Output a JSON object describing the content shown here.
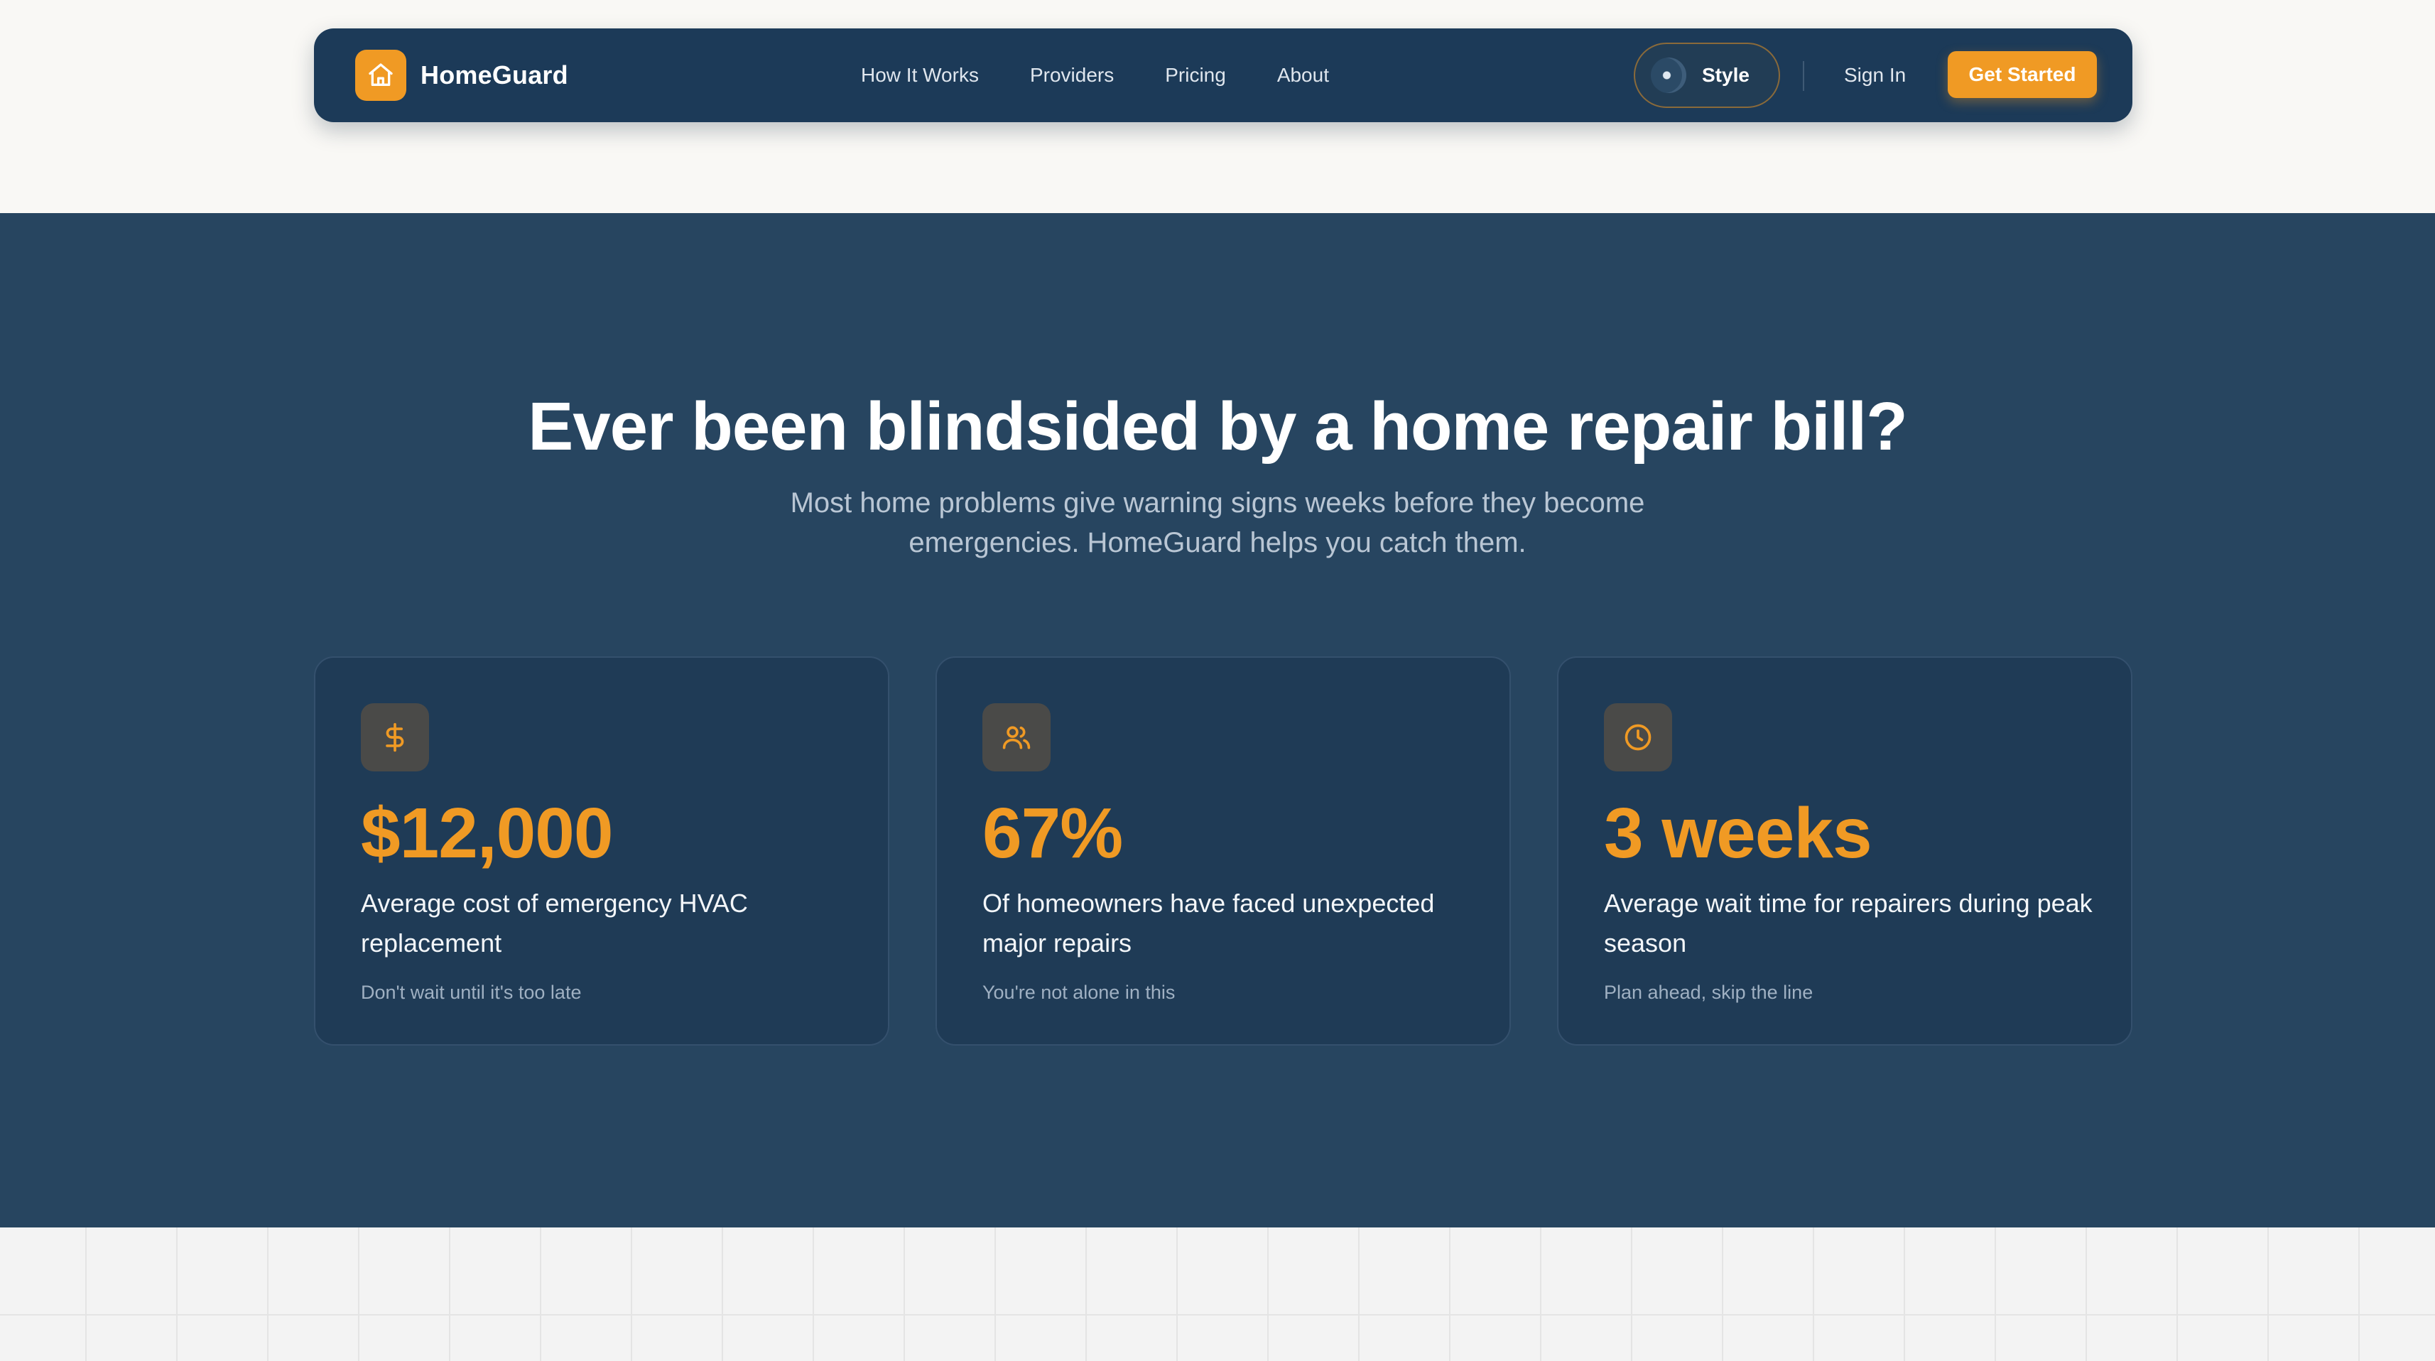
{
  "navbar": {
    "brand": "HomeGuard",
    "brand_icon": "home-icon",
    "links": [
      "How It Works",
      "Providers",
      "Pricing",
      "About"
    ],
    "style_label": "Style",
    "signin_label": "Sign In",
    "cta_label": "Get Started"
  },
  "hero": {
    "title": "Ever been blindsided by a home repair bill?",
    "subtitle": "Most home problems give warning signs weeks before they become emergencies. HomeGuard helps you catch them.",
    "cards": [
      {
        "icon": "dollar-icon",
        "stat": "$12,000",
        "description": "Average cost of emergency HVAC replacement",
        "note": "Don't wait until it's too late"
      },
      {
        "icon": "users-icon",
        "stat": "67%",
        "description": "Of homeowners have faced unexpected major repairs",
        "note": "You're not alone in this"
      },
      {
        "icon": "clock-icon",
        "stat": "3 weeks",
        "description": "Average wait time for repairers during peak season",
        "note": "Plan ahead, skip the line"
      }
    ]
  },
  "colors": {
    "accent": "#f09a24",
    "navbar_bg": "#1c3a58",
    "hero_bg": "#274560",
    "card_bg": "#1f3b56"
  }
}
